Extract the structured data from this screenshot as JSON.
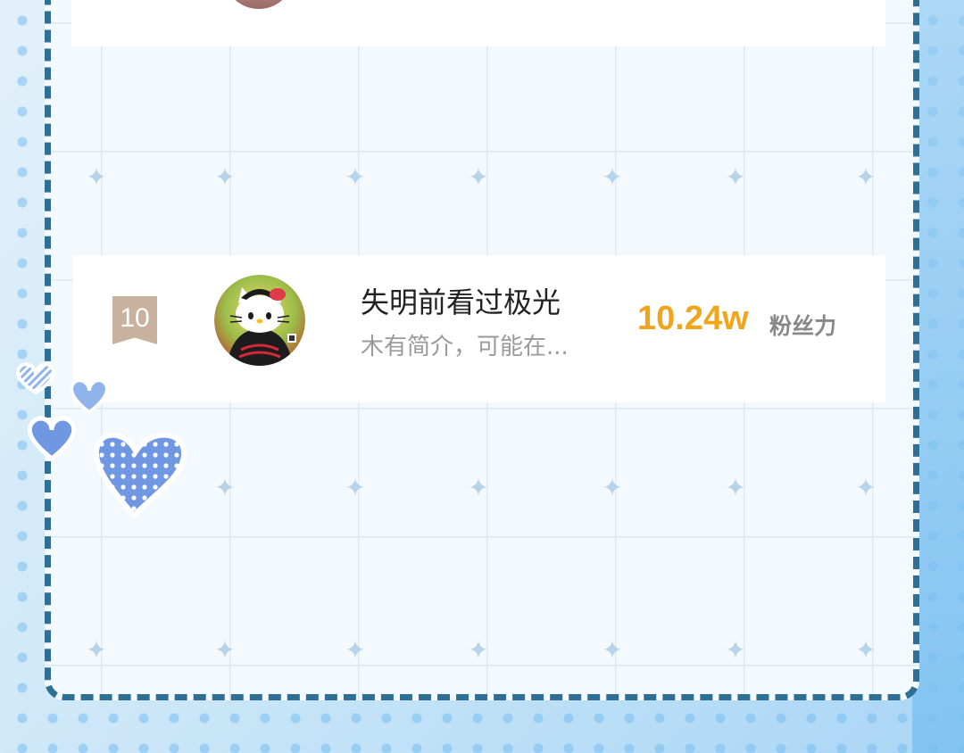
{
  "ranking": {
    "entry": {
      "rank": "10",
      "name": "失明前看过极光",
      "bio": "木有简介，可能在...",
      "fans_count": "10.24w",
      "fans_label": "粉丝力"
    }
  },
  "decorations": {
    "heart_colors": [
      "#8fb4ec",
      "#6f97e2",
      "#5a86d8"
    ],
    "frame_color": "#2f6f93",
    "accent_color": "#f0a51b"
  }
}
